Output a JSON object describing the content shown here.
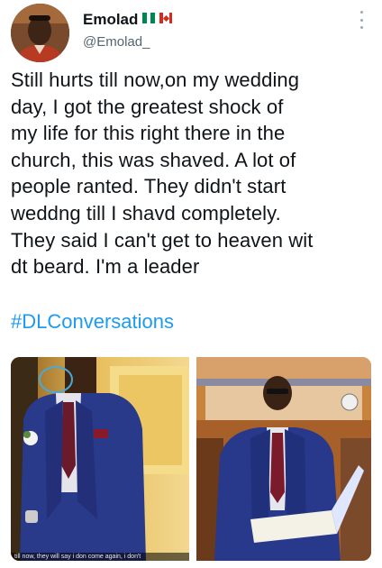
{
  "author": {
    "display_name": "Emolad",
    "handle": "@Emolad_",
    "flags": [
      "nigeria-flag-icon",
      "canada-flag-icon"
    ]
  },
  "tweet": {
    "text": "Still hurts till now,on my wedding\nday, I got the greatest shock of\nmy life for this right there in the\nchurch, this was shaved. A lot of\npeople ranted. They didn't start\nweddng till I shavd completely.\nThey said I can't get to heaven wit\ndt beard. I'm a leader",
    "hashtag": "#DLConversations"
  },
  "media": {
    "left_caption": "till now, they will say i don come again, i don't",
    "icons": [
      "more-options-icon"
    ]
  },
  "colors": {
    "text": "#0f1419",
    "secondary": "#536471",
    "link": "#1d9bf0"
  }
}
